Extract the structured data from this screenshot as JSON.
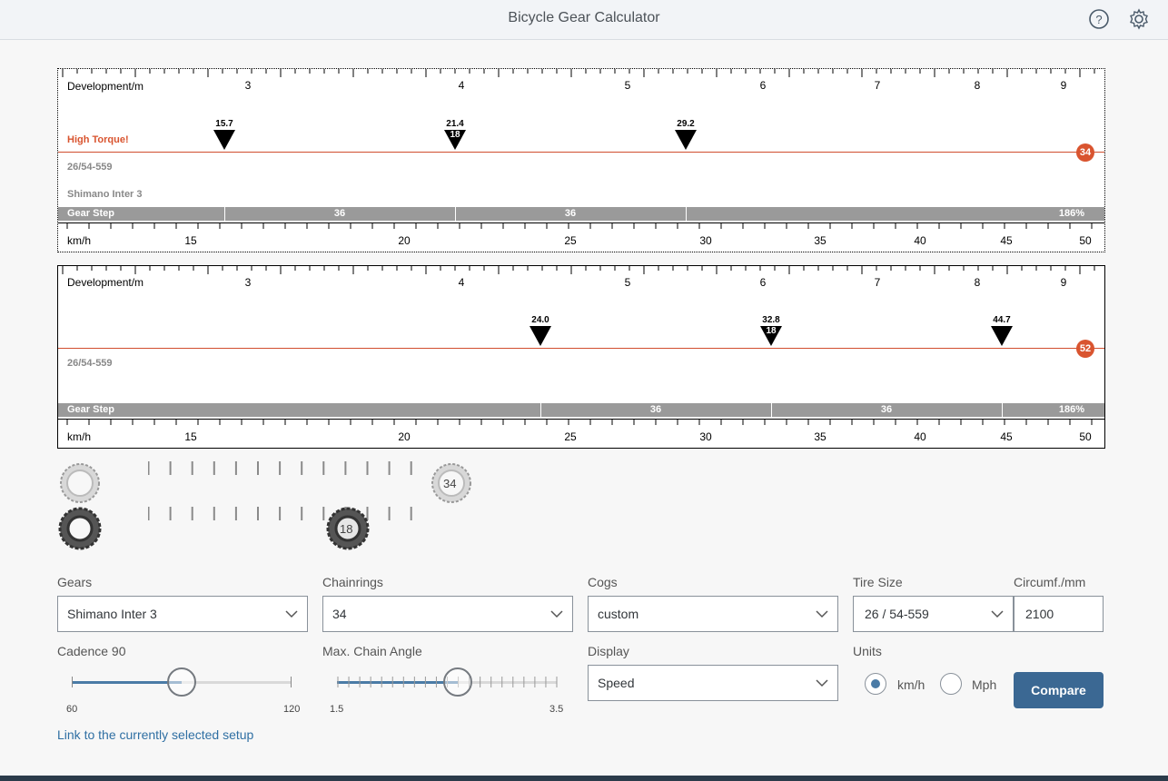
{
  "app": {
    "title": "Bicycle Gear Calculator"
  },
  "header": {
    "help_icon": "question-circle-icon",
    "settings_icon": "gear-icon"
  },
  "panel1": {
    "dev_label": "Development/m",
    "dev_ticks": [
      {
        "label": "3"
      },
      {
        "label": "4"
      },
      {
        "label": "5"
      },
      {
        "label": "6"
      },
      {
        "label": "7"
      },
      {
        "label": "8"
      },
      {
        "label": "9"
      }
    ],
    "warning": "High Torque!",
    "tire": "26/54-559",
    "hub": "Shimano Inter 3",
    "chainring": "34",
    "markers": [
      {
        "value": "15.7",
        "cog": ""
      },
      {
        "value": "21.4",
        "cog": "18"
      },
      {
        "value": "29.2",
        "cog": ""
      }
    ],
    "gear_step_label": "Gear Step",
    "gear_steps": [
      "36",
      "36",
      "186%"
    ],
    "speed_label": "km/h",
    "speed_ticks": [
      {
        "label": "15"
      },
      {
        "label": "20"
      },
      {
        "label": "25"
      },
      {
        "label": "30"
      },
      {
        "label": "35"
      },
      {
        "label": "40"
      },
      {
        "label": "45"
      },
      {
        "label": "50"
      }
    ]
  },
  "panel2": {
    "dev_label": "Development/m",
    "dev_ticks": [
      {
        "label": "3"
      },
      {
        "label": "4"
      },
      {
        "label": "5"
      },
      {
        "label": "6"
      },
      {
        "label": "7"
      },
      {
        "label": "8"
      },
      {
        "label": "9"
      }
    ],
    "tire": "26/54-559",
    "chainring": "52",
    "markers": [
      {
        "value": "24.0",
        "cog": ""
      },
      {
        "value": "32.8",
        "cog": "18"
      },
      {
        "value": "44.7",
        "cog": ""
      }
    ],
    "gear_step_label": "Gear Step",
    "gear_steps": [
      "36",
      "36",
      "186%"
    ],
    "speed_label": "km/h",
    "speed_ticks": [
      {
        "label": "15"
      },
      {
        "label": "20"
      },
      {
        "label": "25"
      },
      {
        "label": "30"
      },
      {
        "label": "35"
      },
      {
        "label": "40"
      },
      {
        "label": "45"
      },
      {
        "label": "50"
      }
    ]
  },
  "selectors": {
    "chainring_value": "34",
    "cog_value": "18",
    "chainring_icon": "chainring-icon",
    "cog_icon": "cog-icon"
  },
  "form": {
    "gears_label": "Gears",
    "gears_value": "Shimano Inter 3",
    "chainrings_label": "Chainrings",
    "chainrings_value": "34",
    "cogs_label": "Cogs",
    "cogs_value": "custom",
    "tire_label": "Tire Size",
    "tire_value": "26 / 54-559",
    "circ_label": "Circumf./mm",
    "circ_value": "2100",
    "cadence_label": "Cadence 90",
    "cadence_min": "60",
    "cadence_max": "120",
    "cadence_value": 90,
    "chain_label": "Max. Chain Angle",
    "chain_min": "1.5",
    "chain_max": "3.5",
    "chain_fraction": 0.55,
    "display_label": "Display",
    "display_value": "Speed",
    "units_label": "Units",
    "unit_kmh": "km/h",
    "unit_mph": "Mph",
    "compare": "Compare",
    "link": "Link to the currently selected setup"
  },
  "colors": {
    "accent": "#d9542f",
    "brand": "#3b6893",
    "slider": "#4a7ba6"
  }
}
